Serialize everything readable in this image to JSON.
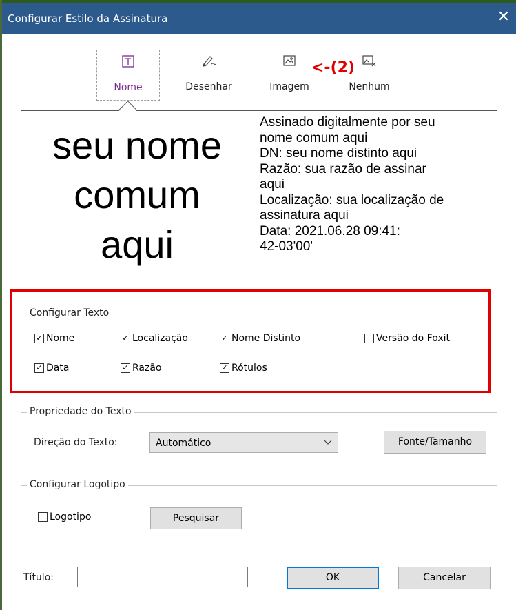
{
  "window": {
    "title": "Configurar Estilo da Assinatura",
    "close_label": "✕"
  },
  "tabs": [
    {
      "label": "Nome",
      "icon": "text-box-icon",
      "selected": true
    },
    {
      "label": "Desenhar",
      "icon": "pen-draw-icon",
      "selected": false
    },
    {
      "label": "Imagem",
      "icon": "image-icon",
      "selected": false
    },
    {
      "label": "Nenhum",
      "icon": "no-image-icon",
      "selected": false
    }
  ],
  "annotation": "<-(2)",
  "preview": {
    "name_lines": [
      "seu nome",
      "comum",
      "aqui"
    ],
    "info_lines": [
      "Assinado digitalmente por seu",
      "nome comum aqui",
      "DN: seu nome distinto aqui",
      "Razão: sua razão de assinar",
      "aqui",
      "Localização: sua localização de",
      "assinatura aqui",
      "Data: 2021.06.28 09:41:",
      "42-03'00'"
    ]
  },
  "configure_text": {
    "legend": "Configurar Texto",
    "options": [
      {
        "label": "Nome",
        "checked": true
      },
      {
        "label": "Localização",
        "checked": true
      },
      {
        "label": "Nome Distinto",
        "checked": true
      },
      {
        "label": "Versão do Foxit",
        "checked": false
      },
      {
        "label": "Data",
        "checked": true
      },
      {
        "label": "Razão",
        "checked": true
      },
      {
        "label": "Rótulos",
        "checked": true
      }
    ]
  },
  "text_property": {
    "legend": "Propriedade do Texto",
    "direction_label": "Direção do Texto:",
    "direction_value": "Automático",
    "font_button": "Fonte/Tamanho"
  },
  "logo": {
    "legend": "Configurar Logotipo",
    "checkbox_label": "Logotipo",
    "checked": false,
    "browse_button": "Pesquisar"
  },
  "footer": {
    "title_label": "Título:",
    "title_value": "",
    "ok": "OK",
    "cancel": "Cancelar"
  },
  "colors": {
    "titlebar": "#2d5a8c",
    "selected_tab_text": "#7b2b8f",
    "annotation": "#e00000",
    "ok_border": "#0078d7"
  }
}
